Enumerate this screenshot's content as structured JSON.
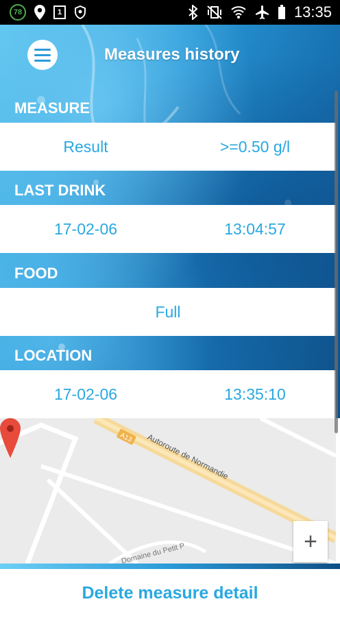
{
  "status_bar": {
    "notification_count": "78",
    "sim_badge": "1",
    "time": "13:35"
  },
  "toolbar": {
    "title": "Measures history",
    "menu_icon": "hamburger-menu-icon"
  },
  "sections": {
    "measure": {
      "header": "MEASURE",
      "label": "Result",
      "value": ">=0.50 g/l"
    },
    "last_drink": {
      "header": "LAST DRINK",
      "date": "17-02-06",
      "time": "13:04:57"
    },
    "food": {
      "header": "FOOD",
      "value": "Full"
    },
    "location": {
      "header": "LOCATION",
      "date": "17-02-06",
      "time": "13:35:10"
    }
  },
  "map": {
    "road_shield": "A13",
    "road_main": "Autoroute de Normandie",
    "road_minor": "Domaine du Petit P",
    "zoom_in_label": "+",
    "pin_color": "#e84a3b"
  },
  "footer": {
    "delete_label": "Delete measure detail"
  },
  "colors": {
    "accent": "#29a8e0",
    "header_blue": "#1f87c8"
  }
}
